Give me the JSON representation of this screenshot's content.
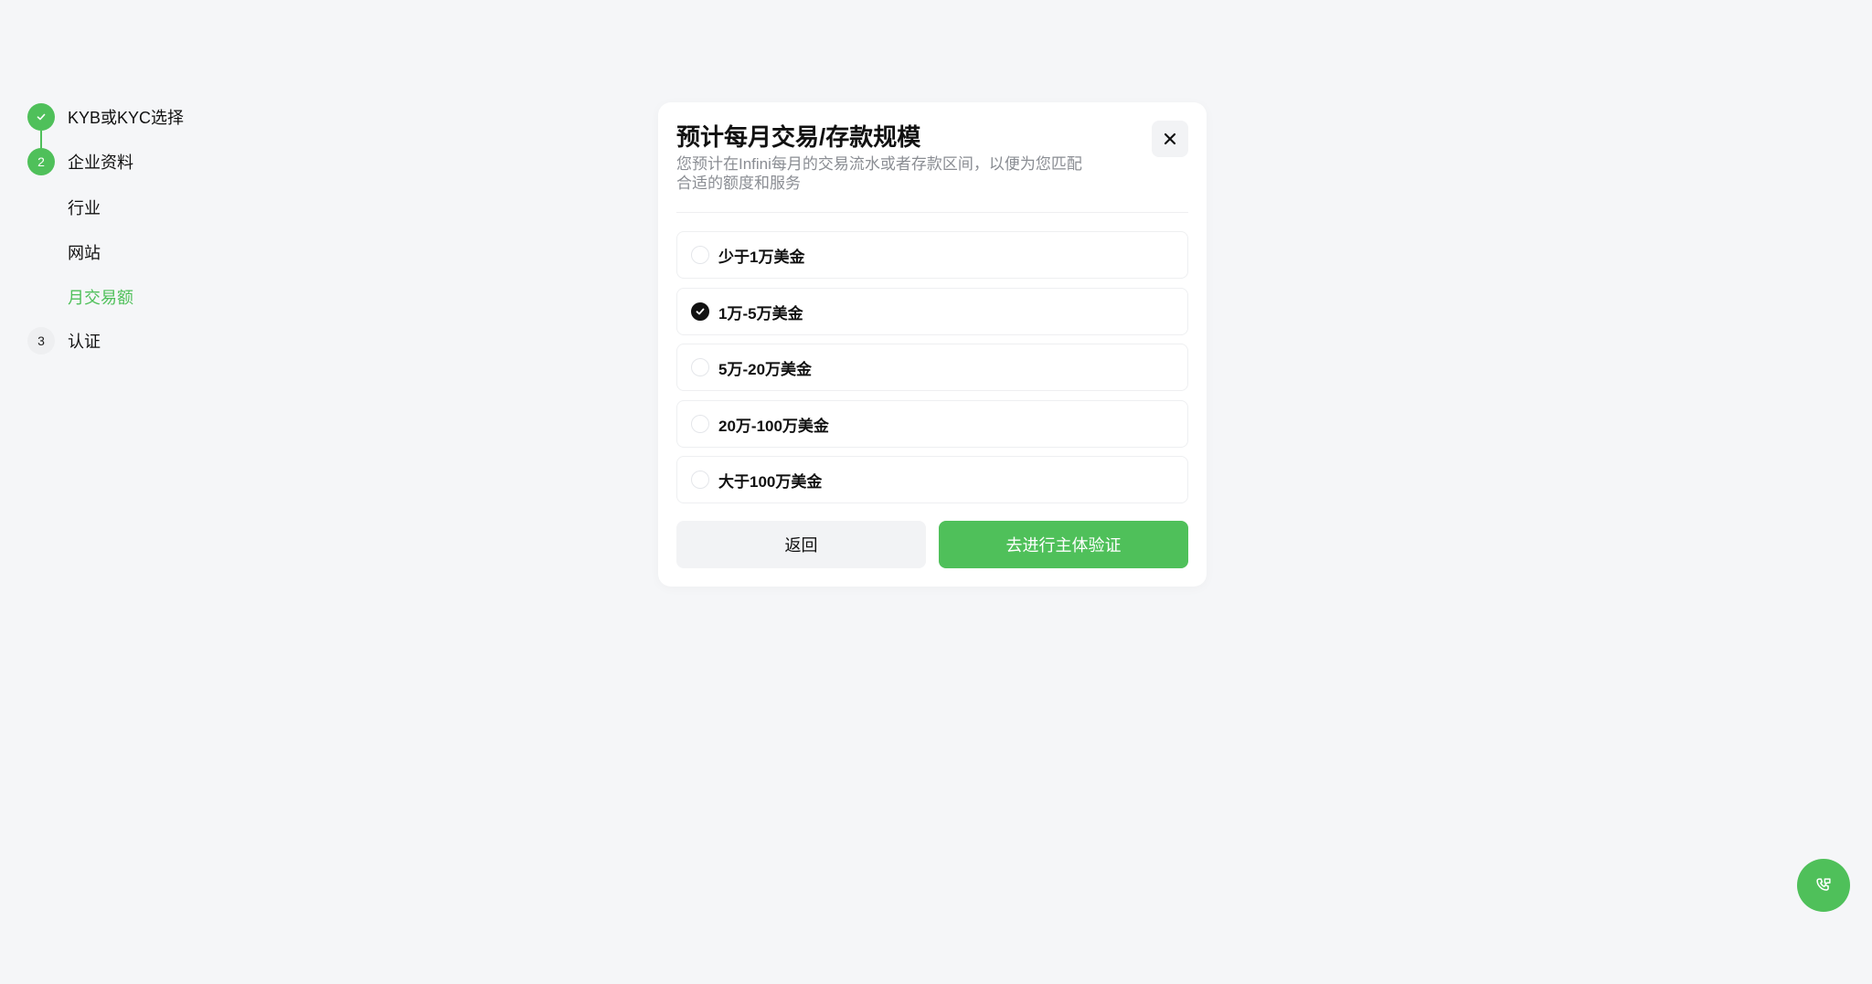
{
  "stepper": {
    "steps": [
      {
        "label": "KYB或KYC选择",
        "status": "done",
        "icon": "check-icon"
      },
      {
        "label": "企业资料",
        "number": "2",
        "status": "current"
      },
      {
        "label": "认证",
        "number": "3",
        "status": "pending"
      }
    ],
    "substeps": [
      {
        "label": "行业"
      },
      {
        "label": "网站"
      },
      {
        "label": "月交易额",
        "active": true
      }
    ]
  },
  "modal": {
    "title": "预计每月交易/存款规模",
    "description": "您预计在Infini每月的交易流水或者存款区间，以便为您匹配合适的额度和服务",
    "close_icon": "close-icon",
    "options": [
      {
        "label": "少于1万美金",
        "selected": false
      },
      {
        "label": "1万-5万美金",
        "selected": true
      },
      {
        "label": "5万-20万美金",
        "selected": false
      },
      {
        "label": "20万-100万美金",
        "selected": false
      },
      {
        "label": "大于100万美金",
        "selected": false
      }
    ],
    "back_label": "返回",
    "primary_label": "去进行主体验证"
  },
  "fab": {
    "icon": "phone-support-icon"
  },
  "colors": {
    "accent": "#4fc05a",
    "background": "#f5f6f8",
    "text": "#111111",
    "muted": "#8a8d93"
  }
}
